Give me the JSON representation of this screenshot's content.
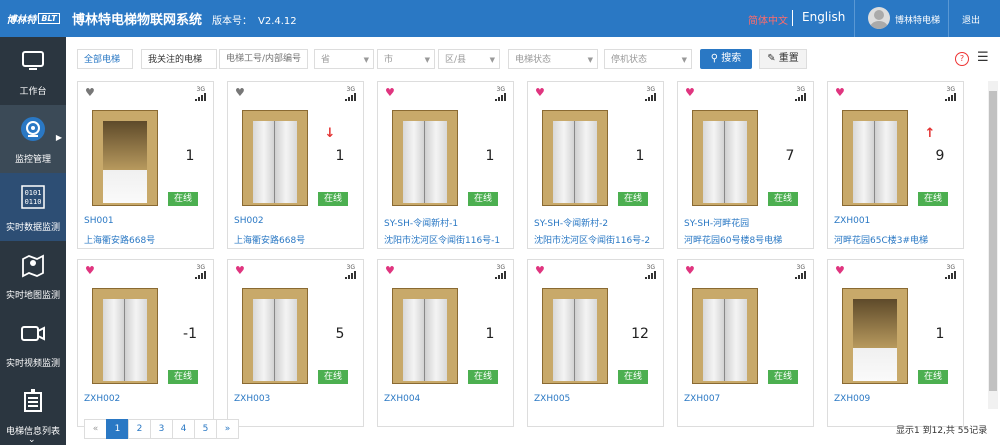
{
  "app": {
    "logo_text": "博林特",
    "logo_badge": "BLT",
    "title": "博林特电梯物联网系统",
    "version_label": "版本号：",
    "version": "V2.4.12",
    "lang_cn": "简体中文",
    "lang_en": "English",
    "username": "博林特电梯",
    "logout": "退出"
  },
  "sidebar": {
    "items": [
      {
        "label": "工作台",
        "icon": "monitor-icon"
      },
      {
        "label": "监控管理",
        "icon": "webcam-icon"
      },
      {
        "label": "实时数据监测",
        "icon": "binary-data-icon"
      },
      {
        "label": "实时地图监测",
        "icon": "map-icon"
      },
      {
        "label": "实时视频监测",
        "icon": "video-camera-icon"
      },
      {
        "label": "电梯信息列表",
        "icon": "list-icon"
      }
    ]
  },
  "filters": {
    "all_elevators": "全部电梯",
    "my_follow": "我关注的电梯",
    "id_placeholder": "电梯工号/内部编号/标",
    "province": "省",
    "city": "市",
    "district": "区/县",
    "elevator_status": "电梯状态",
    "stop_status": "停机状态",
    "search": "搜索",
    "reset": "重置"
  },
  "colors": {
    "primary": "#2a78c4",
    "online": "#4caf50",
    "heart_fav": "#e0357f",
    "heart_none": "#777777",
    "arrow": "#e33333"
  },
  "cards": [
    {
      "code": "SH001",
      "address": "上海衢安路668号",
      "floor": "1",
      "arrow": "",
      "status": "在线",
      "signal": "3G",
      "favorite": false,
      "cabin": "open"
    },
    {
      "code": "SH002",
      "address": "上海衢安路668号",
      "floor": "1",
      "arrow": "down",
      "status": "在线",
      "signal": "3G",
      "favorite": false,
      "cabin": "closed"
    },
    {
      "code": "SY-SH-令闻新村-1",
      "address": "沈阳市沈河区令闻街116号-1",
      "floor": "1",
      "arrow": "",
      "status": "在线",
      "signal": "3G",
      "favorite": true,
      "cabin": "closed"
    },
    {
      "code": "SY-SH-令闻新村-2",
      "address": "沈阳市沈河区令闻街116号-2",
      "floor": "1",
      "arrow": "",
      "status": "在线",
      "signal": "3G",
      "favorite": true,
      "cabin": "closed"
    },
    {
      "code": "SY-SH-河畔花园",
      "address": "河畔花园60号楼8号电梯",
      "floor": "7",
      "arrow": "",
      "status": "在线",
      "signal": "3G",
      "favorite": true,
      "cabin": "closed"
    },
    {
      "code": "ZXH001",
      "address": "河畔花园65C楼3#电梯",
      "floor": "9",
      "arrow": "up",
      "status": "在线",
      "signal": "3G",
      "favorite": true,
      "cabin": "closed"
    },
    {
      "code": "ZXH002",
      "address": "",
      "floor": "-1",
      "arrow": "",
      "status": "在线",
      "signal": "3G",
      "favorite": true,
      "cabin": "closed"
    },
    {
      "code": "ZXH003",
      "address": "",
      "floor": "5",
      "arrow": "",
      "status": "在线",
      "signal": "3G",
      "favorite": true,
      "cabin": "closed"
    },
    {
      "code": "ZXH004",
      "address": "",
      "floor": "1",
      "arrow": "",
      "status": "在线",
      "signal": "3G",
      "favorite": true,
      "cabin": "closed"
    },
    {
      "code": "ZXH005",
      "address": "",
      "floor": "12",
      "arrow": "",
      "status": "在线",
      "signal": "3G",
      "favorite": true,
      "cabin": "closed"
    },
    {
      "code": "ZXH007",
      "address": "",
      "floor": "",
      "arrow": "",
      "status": "在线",
      "signal": "3G",
      "favorite": true,
      "cabin": "closed"
    },
    {
      "code": "ZXH009",
      "address": "",
      "floor": "1",
      "arrow": "",
      "status": "在线",
      "signal": "3G",
      "favorite": true,
      "cabin": "open"
    }
  ],
  "pagination": {
    "prev": "«",
    "pages": [
      "1",
      "2",
      "3",
      "4",
      "5"
    ],
    "next": "»",
    "current": "1",
    "summary": "显示1 到12,共 55记录"
  }
}
